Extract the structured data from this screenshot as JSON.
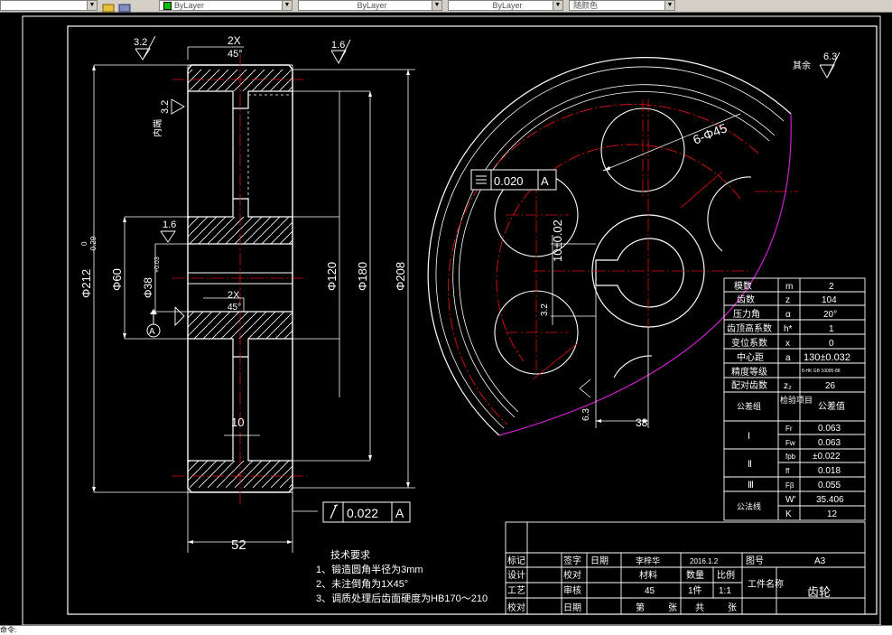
{
  "toolbar": {
    "combos": [
      {
        "value": ""
      },
      {
        "value": "ByLayer"
      },
      {
        "value": "ByLayer"
      },
      {
        "value": "ByLayer"
      },
      {
        "value": "随颜色"
      }
    ]
  },
  "dims": {
    "chamfer_top": "2X",
    "chamfer_top_angle": "45°",
    "chamfer_mid": "2X",
    "chamfer_mid_angle": "45°",
    "rough_32_a": "3.2",
    "rough_16_a": "1.6",
    "rough_32_b": "3.2",
    "rough_16_b": "1.6",
    "rough_32_c": "3.2",
    "rough_63_d": "6.3",
    "rough_other_label": "其余",
    "rough_other_value": "6.3",
    "inner_label": "内端",
    "dia_outer": "Φ212",
    "dia_outer_tol_up": "0",
    "dia_outer_tol_dn": "-0.29",
    "dia_60": "Φ60",
    "dia_38": "Φ38",
    "dia_38_tol": "+0.03",
    "dia_120": "Φ120",
    "dia_180": "Φ180",
    "dia_208": "Φ208",
    "width_52": "52",
    "web_10": "10",
    "datum": "A",
    "tol_runout_value": "0.022",
    "tol_runout_datum": "A",
    "tol_sym_value": "0.020",
    "tol_sym_datum": "A",
    "holes": "6-Φ45",
    "keyway": "10±0.02",
    "key_38": "38"
  },
  "tech": {
    "title": "技术要求",
    "items": [
      "1、锻造圆角半径为3mm",
      "2、未注倒角为1X45°",
      "3、调质处理后齿面硬度为HB170～210"
    ]
  },
  "param_table": {
    "rows": [
      {
        "name": "模数",
        "sym": "m",
        "val": "2"
      },
      {
        "name": "齿数",
        "sym": "z",
        "val": "104"
      },
      {
        "name": "压力角",
        "sym": "α",
        "val": "20°"
      },
      {
        "name": "齿顶高系数",
        "sym": "h*",
        "val": "1"
      },
      {
        "name": "变位系数",
        "sym": "x",
        "val": "0"
      },
      {
        "name": "中心距",
        "sym": "a",
        "val": "130±0.032"
      },
      {
        "name": "精度等级",
        "sym": "",
        "val": "8-HK GB 10095-88"
      },
      {
        "name": "配对齿数",
        "sym": "z₂",
        "val": "26"
      }
    ],
    "head_group": "公差组",
    "head_item": "检验项目",
    "head_val": "公差值",
    "groups": [
      "Ⅰ",
      "Ⅱ",
      "Ⅲ"
    ],
    "checks": [
      {
        "sym": "Fr",
        "val": "0.063"
      },
      {
        "sym": "Fw",
        "val": "0.063"
      },
      {
        "sym": "fpb",
        "val": "±0.022"
      },
      {
        "sym": "ff",
        "val": "0.018"
      },
      {
        "sym": "Fβ",
        "val": "0.055"
      }
    ],
    "common_label": "公法线",
    "common_rows": [
      {
        "sym": "W'",
        "val": "35.406"
      },
      {
        "sym": "K",
        "val": "12"
      }
    ]
  },
  "title_block": {
    "mark": "标记",
    "sign": "签字",
    "date": "日期",
    "designer": "李梓华",
    "design_date": "2016.1.2",
    "drawing_no_label": "图号",
    "drawing_no": "A3",
    "design_label": "设计",
    "proof_label": "校对",
    "material_label": "材料",
    "qty_label": "数量",
    "scale_label": "比例",
    "part_name_label": "工件名称",
    "material": "45",
    "qty": "1件",
    "scale": "1:1",
    "part_name": "齿轮",
    "process_label": "工艺",
    "review_label": "审核",
    "check_label": "校对",
    "approve_label": "日期",
    "sheet_label": "第",
    "sheet_unit": "张",
    "total_label": "共",
    "total_unit": "张"
  },
  "cmdline": {
    "text": "命令:"
  }
}
